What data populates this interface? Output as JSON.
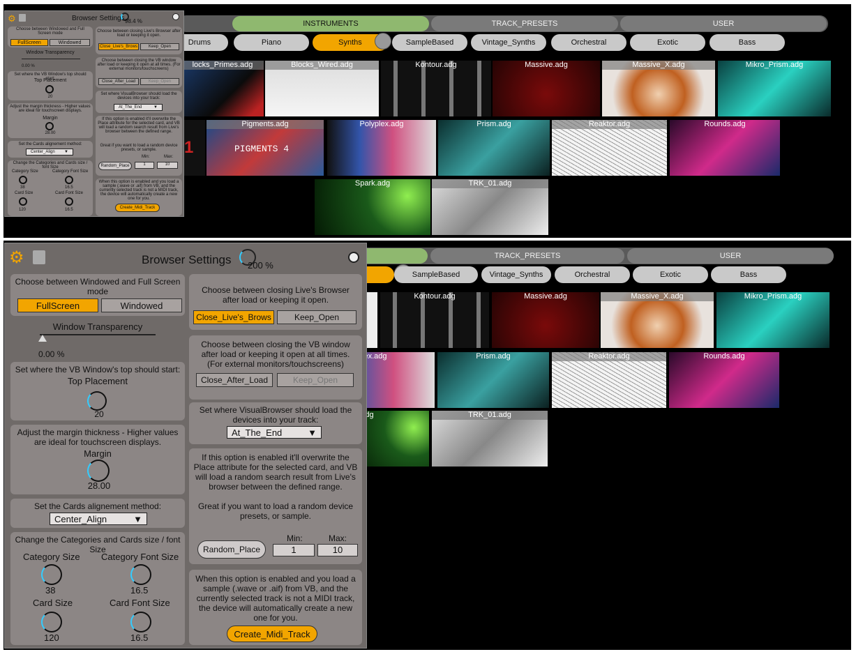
{
  "top": {
    "tabs": [
      "INSTRUMENTS",
      "TRACK_PRESETS",
      "USER"
    ],
    "subtabs": [
      "Drums",
      "Piano",
      "Synths",
      "SampleBased",
      "Vintage_Synths",
      "Orchestral",
      "Exotic",
      "Bass"
    ],
    "cards": [
      "locks_Primes.adg",
      "Blocks_Wired.adg",
      "Kontour.adg",
      "Massive.adg",
      "Massive_X.adg",
      "Mikro_Prism.adg",
      "Pigments.adg",
      "Polyplex.adg",
      "Prism.adg",
      "Reaktor.adg",
      "Rounds.adg",
      "Spark.adg",
      "TRK_01.adg"
    ],
    "pigments_text": "PIGMENTS 4",
    "panel": {
      "title": "Browser Settings",
      "zoom": "98.4 %",
      "win_mode_text": "Choose between Windowed and Full Screen mode",
      "fullscreen": "FullScreen",
      "windowed": "Windowed",
      "transparency_label": "Window Transparency",
      "transparency_value": "0.00 %",
      "top_text": "Set where the VB Window's top should start:",
      "top_label": "Top Placement",
      "top_value": "20",
      "margin_text": "Adjust the margin thickness - Higher values are ideal for touchscreen displays.",
      "margin_label": "Margin",
      "margin_value": "28.00",
      "align_text": "Set the Cards alignement method:",
      "align_value": "Center_Align",
      "sizes_text": "Change the Categories and Cards size / font Size",
      "cat_size": "Category Size",
      "cat_size_v": "38",
      "cat_font": "Category Font Size",
      "cat_font_v": "16.5",
      "card_size": "Card Size",
      "card_size_v": "120",
      "card_font": "Card Font Size",
      "card_font_v": "16.5",
      "close_text": "Choose between closing Live's Browser after load or keeping it open.",
      "close_btn": "Close_Live's_Brows",
      "keep_btn": "Keep_Open",
      "vb_text": "Choose between closing the VB window after load or keeping it open at all times. (For external monitors/touchscreens)",
      "close_after": "Close_After_Load",
      "keep_open2": "Keep_Open",
      "load_text": "Set where VisualBrowser should load the devices into your track:",
      "load_value": "At_The_End",
      "random_text": "If this option is enabled it'll overwrite the Place attribute for the selected card, and  VB will load a random search result from Live's browser between the defined range.",
      "random_text2": "Great if you want to load a random device presets, or sample.",
      "random_btn": "Random_Place",
      "min_label": "Min:",
      "max_label": "Max:",
      "min_value": "1",
      "max_value": "10",
      "midi_text": "When this option is enabled and you load a sample (.wave or .aif) from VB, and the currently selected track is not a MIDI track, the device will automatically create a new one for you.",
      "midi_btn": "Create_Midi_Track"
    }
  },
  "bottom": {
    "tabs": [
      "TRACK_PRESETS",
      "USER"
    ],
    "subtabs": [
      "SampleBased",
      "Vintage_Synths",
      "Orchestral",
      "Exotic",
      "Bass"
    ],
    "cards": [
      "Kontour.adg",
      "Massive.adg",
      "Massive_X.adg",
      "Mikro_Prism.adg",
      "lyplex.adg",
      "Prism.adg",
      "Reaktor.adg",
      "Rounds.adg",
      "rk.adg",
      "TRK_01.adg"
    ],
    "panel": {
      "title": "Browser Settings",
      "zoom": "200 %"
    }
  }
}
